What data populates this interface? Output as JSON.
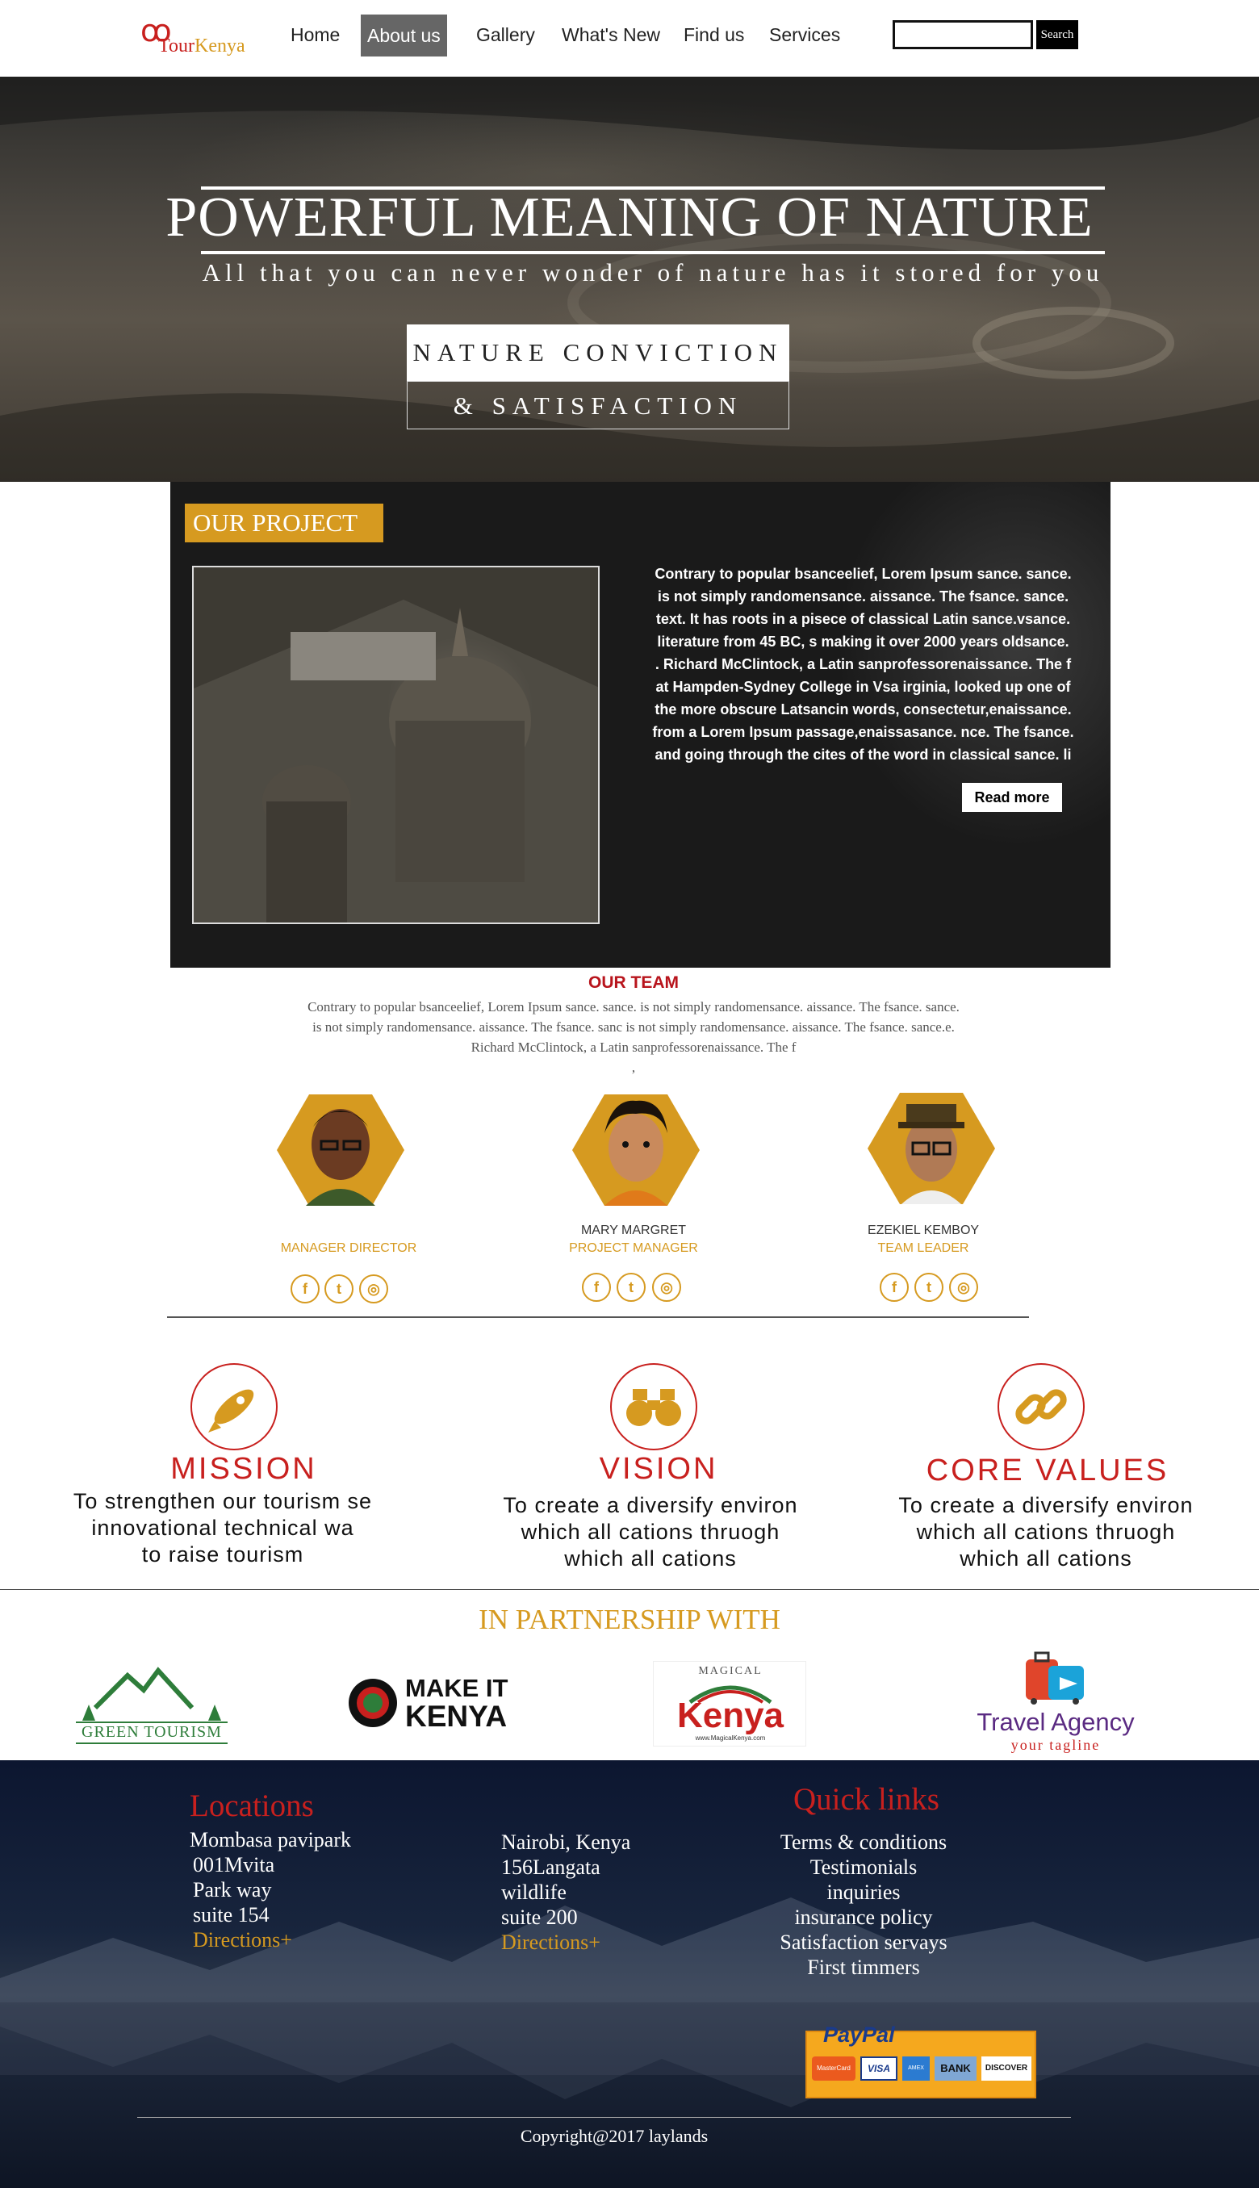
{
  "nav": {
    "logo_mark": "ꝏ",
    "logo_text_a": "Tour",
    "logo_text_b": "Kenya",
    "items": [
      "Home",
      "About us",
      "Gallery",
      "What's New",
      "Find us",
      "Services"
    ],
    "active": "About us",
    "search_placeholder": "",
    "search_button": "Search"
  },
  "hero": {
    "title": "POWERFUL MEANING OF NATURE",
    "subtitle": "All that you can never wonder of nature has it stored for you",
    "button_1": "NATURE CONVICTION",
    "button_2": "& SATISFACTION"
  },
  "project": {
    "badge": "OUR PROJECT",
    "lines": [
      "Contrary to popular bsanceelief, Lorem Ipsum sance.  sance.",
      "is not simply randomensance. aissance. The fsance. sance.",
      "text. It has roots in a pisece of classical Latin sance.vsance.",
      "literature from 45 BC, s making it over 2000 years oldsance.",
      ". Richard McClintock, a Latin sanprofessorenaissance. The f",
      "at Hampden-Sydney College in Vsa  irginia, looked up one of",
      "the more obscure Latsancin words, consectetur,enaissance.",
      "from a Lorem Ipsum passage,enaissasance. nce. The fsance.",
      "and going through the cites of the word in classical sance. li"
    ],
    "read_more": "Read more"
  },
  "team": {
    "title": "OUR TEAM",
    "description": [
      "Contrary to popular bsanceelief, Lorem Ipsum sance.  sance. is not simply randomensance. aissance. The fsance. sance.",
      "is not simply randomensance. aissance. The fsance. sanc is not simply randomensance. aissance. The fsance. sance.e.",
      "Richard McClintock, a Latin sanprofessorenaissance. The f",
      ","
    ],
    "members": [
      {
        "name": "",
        "role": "MANAGER DIRECTOR"
      },
      {
        "name": "MARY MARGRET",
        "role": "PROJECT MANAGER"
      },
      {
        "name": "EZEKIEL KEMBOY",
        "role": "TEAM LEADER"
      }
    ],
    "social": [
      "f",
      "t",
      "◎"
    ]
  },
  "mvv": [
    {
      "title": "MISSION",
      "lines": [
        "To strengthen our tourism se",
        "innovational technical wa",
        "to raise tourism"
      ],
      "icon": "rocket-icon"
    },
    {
      "title": "VISION",
      "lines": [
        "To create a diversify environ",
        "which all cations thruogh",
        "which all cations"
      ],
      "icon": "binoculars-icon"
    },
    {
      "title": "CORE VALUES",
      "lines": [
        "To create a diversify environ",
        "which all cations thruogh",
        "which all cations"
      ],
      "icon": "link-icon"
    }
  ],
  "partners": {
    "title": "IN PARTNERSHIP WITH",
    "logos": [
      {
        "text": "GREEN TOURISM"
      },
      {
        "text_a": "MAKE IT",
        "text_b": "KENYA"
      },
      {
        "text_a": "MAGICAL",
        "text_b": "Kenya",
        "text_c": "www.MagicalKenya.com"
      },
      {
        "text_a": "Travel Agency",
        "text_b": "your tagline"
      }
    ]
  },
  "footer": {
    "locations_title": "Locations",
    "col1": [
      "Mombasa pavipark",
      "001Mvita",
      "Park way",
      "suite 154"
    ],
    "col1_link": "Directions+",
    "col2": [
      "Nairobi, Kenya",
      "156Langata",
      "wildlife",
      "suite 200"
    ],
    "col2_link": "Directions+",
    "quick_title": "Quick links",
    "quick": [
      "Terms & conditions",
      "Testimonials",
      "inquiries",
      "insurance policy",
      "Satisfaction servays",
      "First timmers"
    ],
    "paypal": {
      "brand": "PayPal",
      "cards": [
        "MasterCard",
        "VISA",
        "AMEX",
        "BANK",
        "DISCOVER"
      ]
    },
    "copyright": "Copyright@2017 laylands"
  },
  "colors": {
    "accent_gold": "#d69a20",
    "accent_red": "#c8201e"
  }
}
